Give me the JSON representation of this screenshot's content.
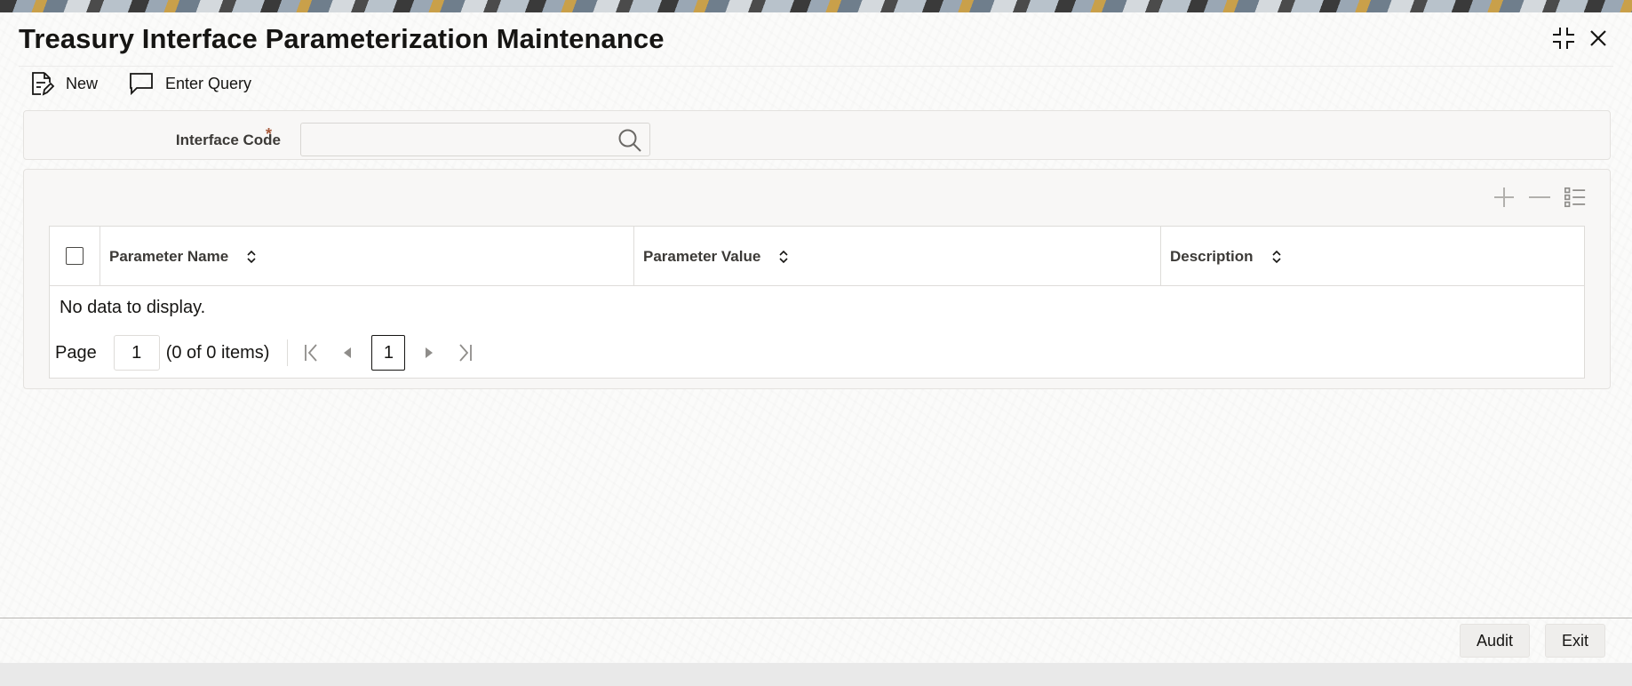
{
  "window": {
    "title": "Treasury Interface Parameterization Maintenance"
  },
  "toolbar": {
    "new_label": "New",
    "enter_query_label": "Enter Query"
  },
  "header_form": {
    "interface_code_label": "Interface Code",
    "required_marker": "*",
    "interface_code_value": ""
  },
  "grid": {
    "columns": [
      "Parameter Name",
      "Parameter Value",
      "Description"
    ],
    "rows": [],
    "empty_message": "No data to display.",
    "pager": {
      "page_label": "Page",
      "page_value": "1",
      "items_summary": "(0 of 0 items)",
      "current_page": "1"
    }
  },
  "footer": {
    "audit_label": "Audit",
    "exit_label": "Exit"
  },
  "colors": {
    "text": "#161513",
    "label": "#3c3a37",
    "required": "#a85a3b",
    "border": "#dedcd9"
  },
  "icons": [
    "maximize-icon",
    "close-icon",
    "new-document-icon",
    "enter-query-icon",
    "search-icon",
    "add-row-icon",
    "delete-row-icon",
    "single-record-view-icon",
    "sort-icon",
    "first-page-icon",
    "previous-page-icon",
    "next-page-icon",
    "last-page-icon"
  ]
}
